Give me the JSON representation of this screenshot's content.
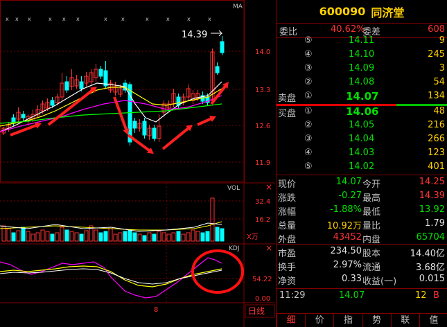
{
  "stock": {
    "code": "600090",
    "name": "同济堂"
  },
  "chart": {
    "ma_label": "MA",
    "vol_label": "VOL",
    "vol_unit": "X万",
    "kdj_label": "KDJ",
    "price_label": "14.39",
    "y_ticks": [
      "14.0",
      "13.3",
      "12.6",
      "11.9"
    ],
    "vol_ticks": [
      "32.4",
      "16.2"
    ],
    "ind_ticks": [
      "54.22",
      "0.00"
    ],
    "x_label": "8",
    "period_label": "日线",
    "close_icon": "close-icon",
    "colors": {
      "up": "#ff3232",
      "down": "#00ffff",
      "ma1": "#ffffff",
      "ma2": "#ffff00",
      "ma3": "#ff00ff",
      "ma4": "#00ff00",
      "arrow": "#ff2020"
    }
  },
  "quote": {
    "weibi_label": "委比",
    "weibi": "40.62%",
    "weicha_label": "委差",
    "weicha": "608",
    "sell_label": "卖盘",
    "buy_label": "买盘",
    "sells": [
      {
        "lvl": "⑤",
        "price": "14.11",
        "vol": "9"
      },
      {
        "lvl": "④",
        "price": "14.10",
        "vol": "245"
      },
      {
        "lvl": "③",
        "price": "14.09",
        "vol": "3"
      },
      {
        "lvl": "②",
        "price": "14.08",
        "vol": "54"
      },
      {
        "lvl": "①",
        "price": "14.07",
        "vol": "134"
      }
    ],
    "buys": [
      {
        "lvl": "①",
        "price": "14.06",
        "vol": "48"
      },
      {
        "lvl": "②",
        "price": "14.05",
        "vol": "216"
      },
      {
        "lvl": "③",
        "price": "14.04",
        "vol": "266"
      },
      {
        "lvl": "④",
        "price": "14.03",
        "vol": "123"
      },
      {
        "lvl": "⑤",
        "price": "14.02",
        "vol": "401"
      }
    ],
    "stats": [
      {
        "l1": "现价",
        "v1": "14.07",
        "c1": "green",
        "l2": "今开",
        "v2": "14.25",
        "c2": "red"
      },
      {
        "l1": "涨跌",
        "v1": "-0.27",
        "c1": "green",
        "l2": "最高",
        "v2": "14.39",
        "c2": "red"
      },
      {
        "l1": "涨幅",
        "v1": "-1.88%",
        "c1": "green",
        "l2": "最低",
        "v2": "13.92",
        "c2": "green"
      },
      {
        "l1": "总量",
        "v1": "10.92万",
        "c1": "yellow",
        "l2": "量比",
        "v2": "1.79",
        "c2": "white"
      },
      {
        "l1": "外盘",
        "v1": "43452",
        "c1": "red",
        "l2": "内盘",
        "v2": "65704",
        "c2": "green"
      }
    ],
    "stats2": [
      {
        "l1": "市盈",
        "v1": "234.50",
        "l2": "股本",
        "v2": "14.40亿"
      },
      {
        "l1": "换手",
        "v1": "2.97%",
        "l2": "流通",
        "v2": "3.68亿"
      },
      {
        "l1": "净资",
        "v1": "0.33",
        "l2": "收益(一)",
        "v2": "0.015"
      }
    ],
    "tick": {
      "time": "11:29",
      "price": "14.07",
      "vol": "12",
      "side": "B"
    }
  },
  "tabs": [
    "细",
    "价",
    "指",
    "势",
    "联",
    "值"
  ]
}
